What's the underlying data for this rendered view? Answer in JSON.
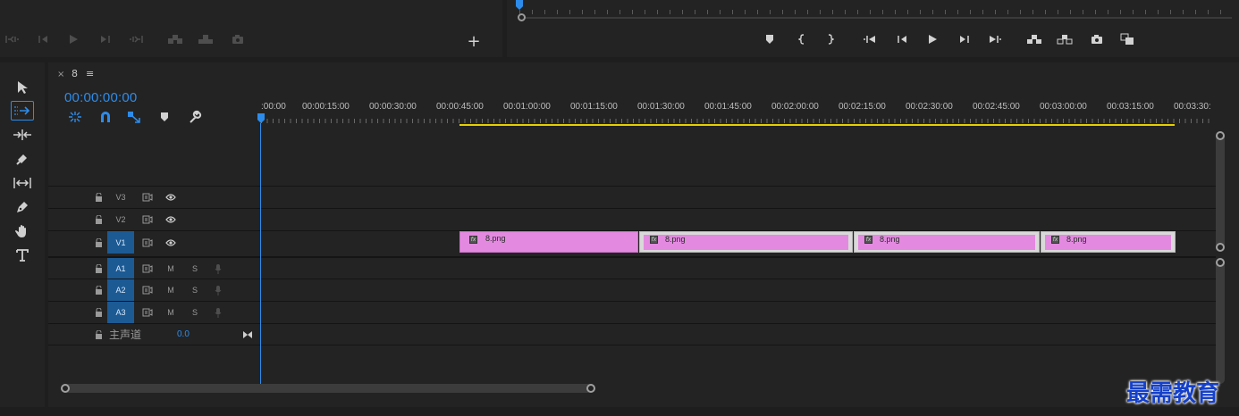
{
  "source_monitor": {
    "controls": [
      "step-to-in-icon",
      "step-back-icon",
      "play-icon",
      "step-forward-icon",
      "step-to-out-icon",
      "insert-icon",
      "overwrite-icon",
      "export-frame-icon"
    ],
    "add_button_label": "+"
  },
  "program_monitor": {
    "controls": [
      "add-marker-icon",
      "mark-in-icon",
      "mark-out-icon",
      "go-to-in-icon",
      "step-back-icon",
      "play-icon",
      "step-forward-icon",
      "go-to-out-icon",
      "lift-icon",
      "extract-icon",
      "export-frame-icon",
      "compare-icon"
    ]
  },
  "tools": [
    "selection-tool-icon",
    "track-select-tool-icon",
    "ripple-edit-tool-icon",
    "razor-tool-icon",
    "slip-tool-icon",
    "pen-tool-icon",
    "hand-tool-icon",
    "type-tool-icon"
  ],
  "timeline": {
    "close_label": "×",
    "sequence_name": "8",
    "menu_label": "≡",
    "timecode": "00:00:00:00",
    "ruler_labels": [
      ":00:00",
      "00:00:15:00",
      "00:00:30:00",
      "00:00:45:00",
      "00:01:00:00",
      "00:01:15:00",
      "00:01:30:00",
      "00:01:45:00",
      "00:02:00:00",
      "00:02:15:00",
      "00:02:30:00",
      "00:02:45:00",
      "00:03:00:00",
      "00:03:15:00",
      "00:03:30:"
    ],
    "video_tracks": [
      {
        "name": "V3",
        "targeted": false
      },
      {
        "name": "V2",
        "targeted": false
      },
      {
        "name": "V1",
        "targeted": true
      }
    ],
    "audio_tracks": [
      {
        "name": "A1",
        "mute": "M",
        "solo": "S"
      },
      {
        "name": "A2",
        "mute": "M",
        "solo": "S"
      },
      {
        "name": "A3",
        "mute": "M",
        "solo": "S"
      }
    ],
    "master": {
      "label": "主声道",
      "value": "0.0"
    },
    "clips": [
      {
        "name": "8.png",
        "fx": "fx"
      },
      {
        "name": "8.png",
        "fx": "fx"
      },
      {
        "name": "8.png",
        "fx": "fx"
      },
      {
        "name": "8.png",
        "fx": "fx"
      }
    ]
  },
  "colors": {
    "accent": "#2d8ceb",
    "clip": "#e38ae0",
    "work_area": "#e6cf00",
    "watermark": "#1540c8"
  },
  "watermark": "最需教育"
}
